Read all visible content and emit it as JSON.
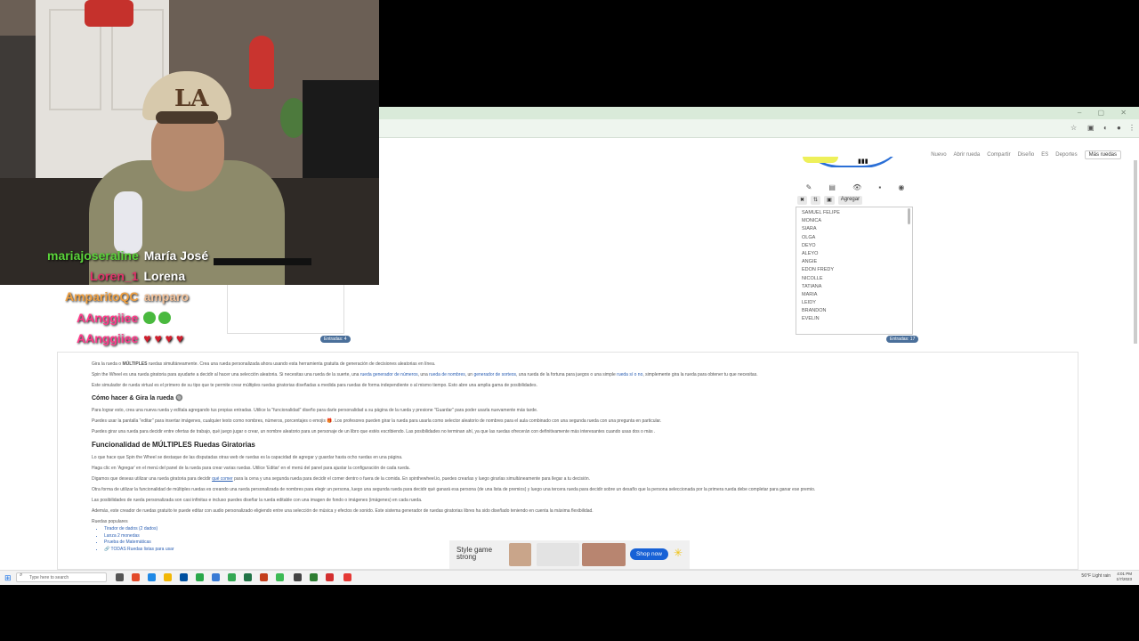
{
  "browser": {
    "toolbar_icons": [
      "star-icon",
      "extensions-icon",
      "menu-icon"
    ]
  },
  "site": {
    "nav_items": [
      "Nuevo",
      "Abrir rueda",
      "Compartir",
      "Diseño",
      "ES",
      "Deportes"
    ],
    "nav_button": "Más ruedas"
  },
  "wheel_panel": {
    "add_button": "Agregar",
    "names": [
      "SAMUEL FELIPE",
      "MONICA",
      "SIARA",
      "OLGA",
      "DEYO",
      "ALEYO",
      "ANGIE",
      "EDON FREDY",
      "NICOLLE",
      "TATIANA",
      "MARIA",
      "LEIDY",
      "BRANDON",
      "EVELIN"
    ],
    "entries_badge": "Entradas: 17",
    "left_badge": "Entradas: 4"
  },
  "article": {
    "p1_start": "Gira la rueda o ",
    "p1_bold": "MÚLTIPLES",
    "p1_end": " ruedas simultáneamente. Crea una rueda personalizada ahora usando esta herramienta gratuita de generación de decisiones aleatorias en línea.",
    "p2_start": "Spin the Wheel es una rueda giratoria para ayudarte a decidir al hacer una selección aleatoria. Si necesitas una rueda de la suerte, una ",
    "p2_link1": "rueda generador de números",
    "p2_mid1": ", una ",
    "p2_link2": "rueda de nombres",
    "p2_mid2": ", un ",
    "p2_link3": "generador de sorteos",
    "p2_mid3": ", una rueda de la fortuna para juegos o una simple ",
    "p2_link4": "rueda sí o no",
    "p2_end": ", simplemente gira la rueda para obtener tu que necesitas.",
    "p3": "Este simulador de rueda virtual es el primero de su tipo que te permite crear múltiples ruedas giratorias diseñadas a medida para ruedas de forma independiente o al mismo tiempo. Esto abre una amplia gama de posibilidades.",
    "h_howto": "Cómo hacer & Gira la rueda 🔘",
    "p4": "Para lograr esto, crea una nueva rueda y edítala agregando tus propias entradas. Utilice la \"funcionalidad\" diseño para darle personalidad a su página de la rueda y presione \"Guardar\" para poder usarla nuevamente más tarde.",
    "p5": "Puedes usar la pantalla \"editar\" para insertar imágenes, cualquier texto como nombres, números, porcentajes o emojis 🎁. Los profesores pueden girar la rueda para usarla como selector aleatorio de nombres para el aula combinado con una segunda rueda con una pregunta en particular.",
    "p6": "Puedes girar una rueda para decidir entre ofertas de trabajo, qué juego jugar o crear, un nombre aleatorio para un personaje de un libro que estés escribiendo. Las posibilidades no terminan ahí, ya que las ruedas ofrecerán con definitivamente más interesantes cuando usas dos o más .",
    "h_multi": "Funcionalidad de MÚLTIPLES Ruedas Giratorias",
    "p7": "Lo que hace que Spin the Wheel se destaque de las disputadas otras web de ruedas es la capacidad de agregar y guardar hasta ocho ruedas en una página.",
    "p8": "Haga clic en 'Agregar' en el menú del panel de la rueda para crear varias ruedas. Utilice 'Editar' en el menú del panel para ajustar la configuración de cada rueda.",
    "p9_start": "Digamos que deseas utilizar una rueda giratoria para decidir ",
    "p9_link": "qué comer",
    "p9_end": " para la cena y una segunda rueda para decidir el comer dentro o fuera de la comida. En spinthewheel.io, puedes crearlas y luego girarlas simultáneamente para llegar a tu decisión.",
    "p10": "Otra forma de utilizar la funcionalidad de múltiples ruedas es creando una rueda personalizada de nombres para elegir un persona, luego una segunda rueda para decidir qué ganará esa persona (de una lista de premios) y luego una tercera rueda para decidir sobre un desafío que la persona seleccionada por la primera rueda debe completar para ganar ese premio.",
    "p11": "Las posibilidades de rueda personalizada son casi infinitas e incluso puedes diseñar la rueda editable con una imagen de fondo o imágenes (imágenes) en cada rueda.",
    "p12": "Además, este creador de ruedas gratuito te puede editar con audio personalizado eligiendo entre una selección de música y efectos de sonido. Este sistema generador de ruedas giratorias libres ha sido diseñado teniendo en cuenta la máxima flexibilidad.",
    "popular_label": "Ruedas populares",
    "popular": [
      "Tirador de dados (2 dados)",
      "Lanza 2 monedas",
      "Prueba de Matemáticas",
      "🔗 TODAS Ruedas listas para usar"
    ]
  },
  "ad": {
    "headline": "Style game strong",
    "cta": "Shop now"
  },
  "taskbar": {
    "search_placeholder": "Type here to search",
    "weather": "56°F  Light rain",
    "time": "4:01 PM",
    "date": "1/7/2023"
  },
  "stream": {
    "cap_logo": "LA",
    "chat": [
      {
        "user": "mariajoseraline",
        "message": "María José",
        "color": "#5ad43a"
      },
      {
        "user": "Loren_1",
        "message": "Lorena",
        "color": "#e0336b"
      },
      {
        "user": "AmparitoQC",
        "message": "amparo",
        "color": "#f0a040"
      },
      {
        "user": "AAnggiiee",
        "message": "",
        "color": "#ff3a8a"
      },
      {
        "user": "AAnggiiee",
        "message": "",
        "color": "#ff3a8a"
      }
    ]
  }
}
